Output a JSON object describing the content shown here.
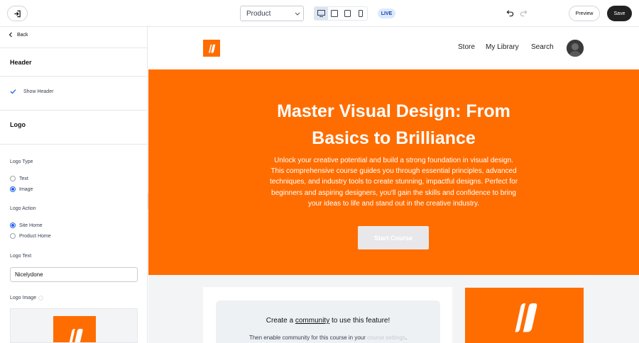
{
  "topbar": {
    "select_value": "Product",
    "live_badge": "LIVE",
    "preview_label": "Preview",
    "save_label": "Save"
  },
  "sidebar": {
    "back_label": "Back",
    "header_section": "Header",
    "show_header_label": "Show Header",
    "logo_section": "Logo",
    "logo_type_label": "Logo Type",
    "logo_type_options": [
      "Text",
      "Image"
    ],
    "logo_type_selected": "Image",
    "logo_action_label": "Logo Action",
    "logo_action_options": [
      "Site Home",
      "Product Home"
    ],
    "logo_action_selected": "Site Home",
    "logo_text_label": "Logo Text",
    "logo_text_value": "Nicelydone",
    "logo_image_label": "Logo Image"
  },
  "site": {
    "nav": [
      "Store",
      "My Library",
      "Search"
    ],
    "hero_title_line1": "Master Visual Design: From",
    "hero_title_line2": "Basics to Brilliance",
    "hero_desc": "Unlock your creative potential and build a strong foundation in visual design. This comprehensive course guides you through essential principles, advanced techniques, and industry tools to create stunning, impactful designs. Perfect for beginners and aspiring designers, you'll gain the skills and confidence to bring your ideas to life and stand out in the creative industry.",
    "cta_label": "Start Course",
    "card_title_pre": "Create a ",
    "card_title_link": "community",
    "card_title_post": " to use this feature!",
    "card_sub_pre": "Then enable community for this course in your ",
    "card_sub_link": "course settings",
    "card_sub_post": "."
  },
  "colors": {
    "brand": "#ff6d00",
    "save_bg": "#222222",
    "live_bg": "#dbeafe"
  }
}
